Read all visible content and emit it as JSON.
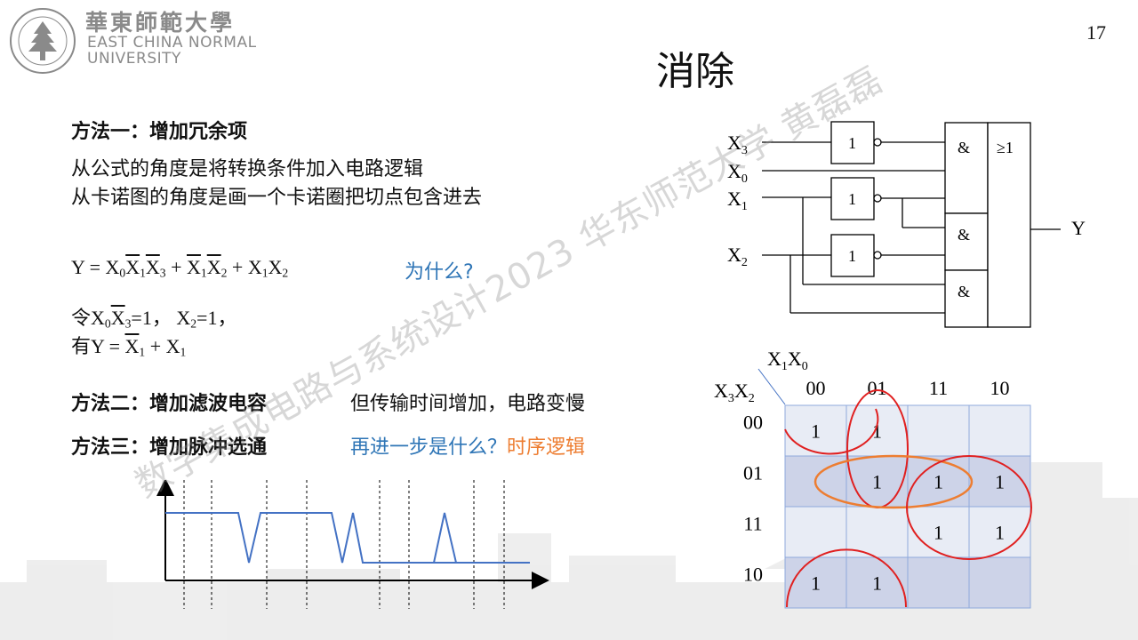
{
  "header": {
    "logo_cn": "華東師範大學",
    "logo_en_line1": "EAST CHINA NORMAL",
    "logo_en_line2": "UNIVERSITY",
    "page_number": "17",
    "title": "消除"
  },
  "method1": {
    "heading": "方法一：增加冗余项",
    "line1": "从公式的角度是将转换条件加入电路逻辑",
    "line2": "从卡诺图的角度是画一个卡诺圈把切点包含进去",
    "why": "为什么?",
    "let_prefix": "令",
    "let_cond1": "=1，",
    "let_cond2": "=1，",
    "have_prefix": "有"
  },
  "method2": {
    "heading": "方法二：增加滤波电容",
    "note": "但传输时间增加，电路变慢"
  },
  "method3": {
    "heading": "方法三：增加脉冲选通",
    "question": "再进一步是什么？",
    "answer": "时序逻辑"
  },
  "circuit": {
    "inputs": [
      "X3",
      "X0",
      "X1",
      "X2"
    ],
    "not_label": "1",
    "and_label": "&",
    "or_label": "≥1",
    "output": "Y"
  },
  "kmap": {
    "col_var": "X1X0",
    "row_var": "X3X2",
    "col_headers": [
      "00",
      "01",
      "11",
      "10"
    ],
    "row_headers": [
      "00",
      "01",
      "11",
      "10"
    ],
    "cells": [
      [
        "1",
        "1",
        "",
        ""
      ],
      [
        "",
        "1",
        "1",
        "1"
      ],
      [
        "",
        "",
        "1",
        "1"
      ],
      [
        "1",
        "1",
        "",
        ""
      ]
    ],
    "colors": {
      "light": "#e8ecf5",
      "dark": "#cdd3e8",
      "border": "#8faadc",
      "circle": "#e02020",
      "redundant": "#ed7d31"
    }
  },
  "watermark": "数字集成电路与系统设计2023 华东师范大学 黄磊磊"
}
